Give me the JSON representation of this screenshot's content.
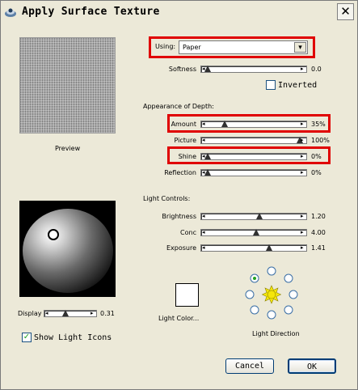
{
  "window": {
    "title": "Apply Surface Texture",
    "close_glyph": "✕"
  },
  "preview": {
    "label": "Preview"
  },
  "using": {
    "label": "Using:",
    "value": "Paper",
    "arrow_glyph": "▾"
  },
  "softness": {
    "label": "Softness",
    "value": "0.0",
    "level": 0.0
  },
  "inverted": {
    "label": "Inverted",
    "checked": false
  },
  "depth": {
    "heading": "Appearance of Depth:",
    "sliders": [
      {
        "label": "Amount",
        "value": "35%",
        "level": 0.18
      },
      {
        "label": "Picture",
        "value": "100%",
        "level": 1.0
      },
      {
        "label": "Shine",
        "value": "0%",
        "level": 0.0
      },
      {
        "label": "Reflection",
        "value": "0%",
        "level": 0.0
      }
    ]
  },
  "light_controls": {
    "heading": "Light Controls:",
    "sliders": [
      {
        "label": "Brightness",
        "value": "1.20",
        "level": 0.56
      },
      {
        "label": "Conc",
        "value": "4.00",
        "level": 0.53
      },
      {
        "label": "Exposure",
        "value": "1.41",
        "level": 0.67
      }
    ]
  },
  "display": {
    "label": "Display",
    "value": "0.31",
    "level": 0.38
  },
  "show_light_icons": {
    "label": "Show Light Icons",
    "checked": true,
    "check_glyph": "✓"
  },
  "light_color": {
    "label": "Light Color...",
    "swatch": "#ffffff"
  },
  "light_direction": {
    "label": "Light Direction",
    "selected_index": 7
  },
  "buttons": {
    "cancel": "Cancel",
    "ok": "OK"
  },
  "slider_end_left": "◂",
  "slider_end_right": "▸",
  "colors": {
    "highlight": "#e00000",
    "sun": "#f5e60a",
    "light_ring": "#3a6ea5",
    "check": "#21a121"
  }
}
